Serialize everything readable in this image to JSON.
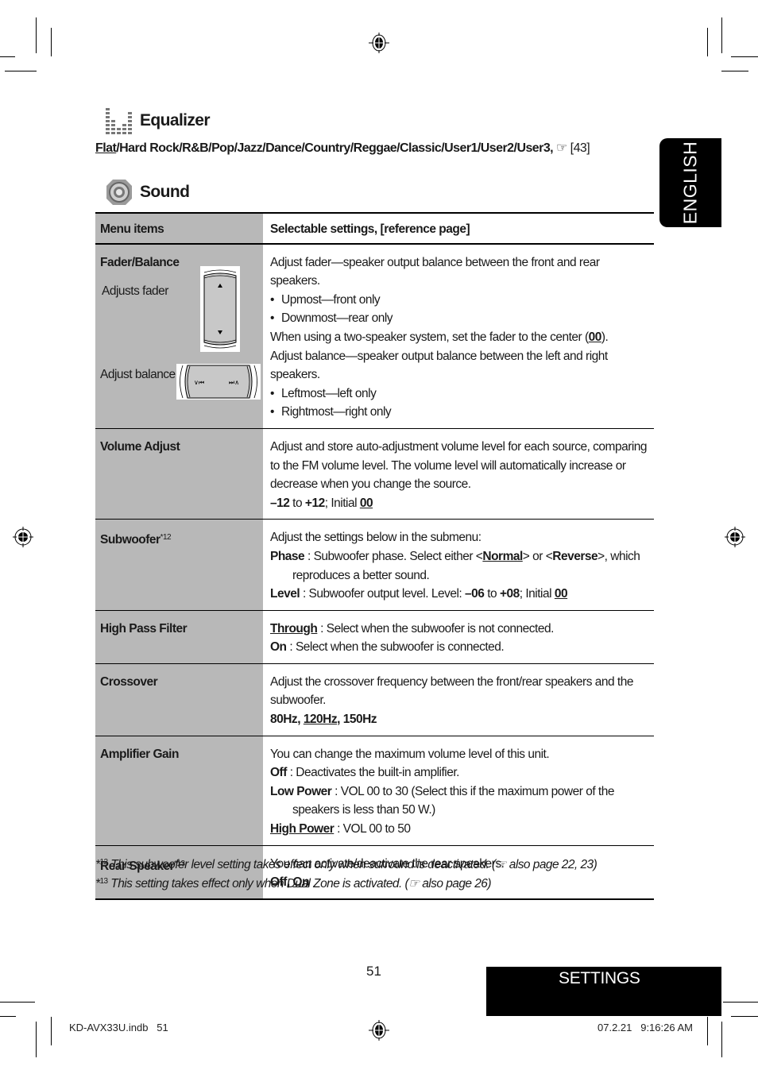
{
  "equalizer": {
    "title": "Equalizer",
    "icon": "equalizer-bars-icon",
    "options": [
      "Flat",
      "Hard Rock",
      "R&B",
      "Pop",
      "Jazz",
      "Dance",
      "Country",
      "Reggae",
      "Classic",
      "User1",
      "User2",
      "User3"
    ],
    "default_option": "Flat",
    "ref_symbol": "☞",
    "ref_page": "[43]"
  },
  "sound": {
    "title": "Sound",
    "icon": "speaker-icon"
  },
  "language_tab": "ENGLISH",
  "table": {
    "headers": [
      "Menu items",
      "Selectable settings, [reference page]"
    ],
    "fader_balance": {
      "name": "Fader/Balance",
      "adjusts_fader_label": "Adjusts fader",
      "adjust_balance_label": "Adjust balance",
      "lines": {
        "l1": "Adjust fader—speaker output balance between the front and rear speakers.",
        "b1": "Upmost—front only",
        "b2": "Downmost—rear only",
        "l2_pre": "When using a two-speaker system, set the fader to the center (",
        "l2_val": "00",
        "l2_post": ").",
        "l3": "Adjust balance—speaker output balance between the left and right speakers.",
        "b3": "Leftmost—left only",
        "b4": "Rightmost—right only"
      }
    },
    "volume_adjust": {
      "name": "Volume Adjust",
      "text": "Adjust and store auto-adjustment volume level for each source, comparing to the FM volume level. The volume level will automatically increase or decrease when you change the source.",
      "min": "–12",
      "to": " to ",
      "max": "+12",
      "initial_label": "; Initial ",
      "initial": "00"
    },
    "subwoofer": {
      "name": "Subwoofer",
      "note": "*12",
      "intro": "Adjust the settings below in the submenu:",
      "phase_label": "Phase",
      "phase_text_1": " : Subwoofer phase. Select either <",
      "phase_normal": "Normal",
      "phase_text_2": "> or <",
      "phase_reverse": "Reverse",
      "phase_text_3": ">, which reproduces a better sound.",
      "level_label": "Level",
      "level_text": " : Subwoofer output level. Level: ",
      "level_min": "–06",
      "level_to": " to ",
      "level_max": "+08",
      "level_initial_label": "; Initial ",
      "level_initial": "00"
    },
    "high_pass_filter": {
      "name": "High Pass Filter",
      "through_label": "Through",
      "through_text": " : Select when the subwoofer is not connected.",
      "on_label": "On",
      "on_text": " : Select when the subwoofer is connected."
    },
    "crossover": {
      "name": "Crossover",
      "text": "Adjust the crossover frequency between the front/rear speakers and the subwoofer.",
      "options": [
        "80Hz",
        "120Hz",
        "150Hz"
      ],
      "default_option": "120Hz"
    },
    "amplifier_gain": {
      "name": "Amplifier Gain",
      "intro": "You can change the maximum volume level of this unit.",
      "off_label": "Off",
      "off_text": " : Deactivates the built-in amplifier.",
      "low_label": "Low Power",
      "low_text": " : VOL 00 to 30 (Select this if the maximum power of the speakers is less than 50 W.)",
      "high_label": "High Power",
      "high_text": " : VOL 00 to 50"
    },
    "rear_speaker": {
      "name": "Rear Speaker",
      "note": "*13",
      "intro": "You can activate/deactivate the rear speakers.",
      "options": [
        "Off",
        "On"
      ],
      "default_option": "On"
    }
  },
  "footnotes": [
    {
      "mark": "*",
      "num": "12",
      "text": "This subwoofer level setting takes effect only when surround is deactivated. (☞ also page 22, 23)"
    },
    {
      "mark": "*",
      "num": "13",
      "text": "This setting takes effect only when Dual Zone is activated. (☞ also page 26)"
    }
  ],
  "footer": {
    "page_number": "51",
    "section_tab": "SETTINGS",
    "slug_left": "KD-AVX33U.indb   51",
    "slug_right": "07.2.21   9:16:26 AM"
  }
}
